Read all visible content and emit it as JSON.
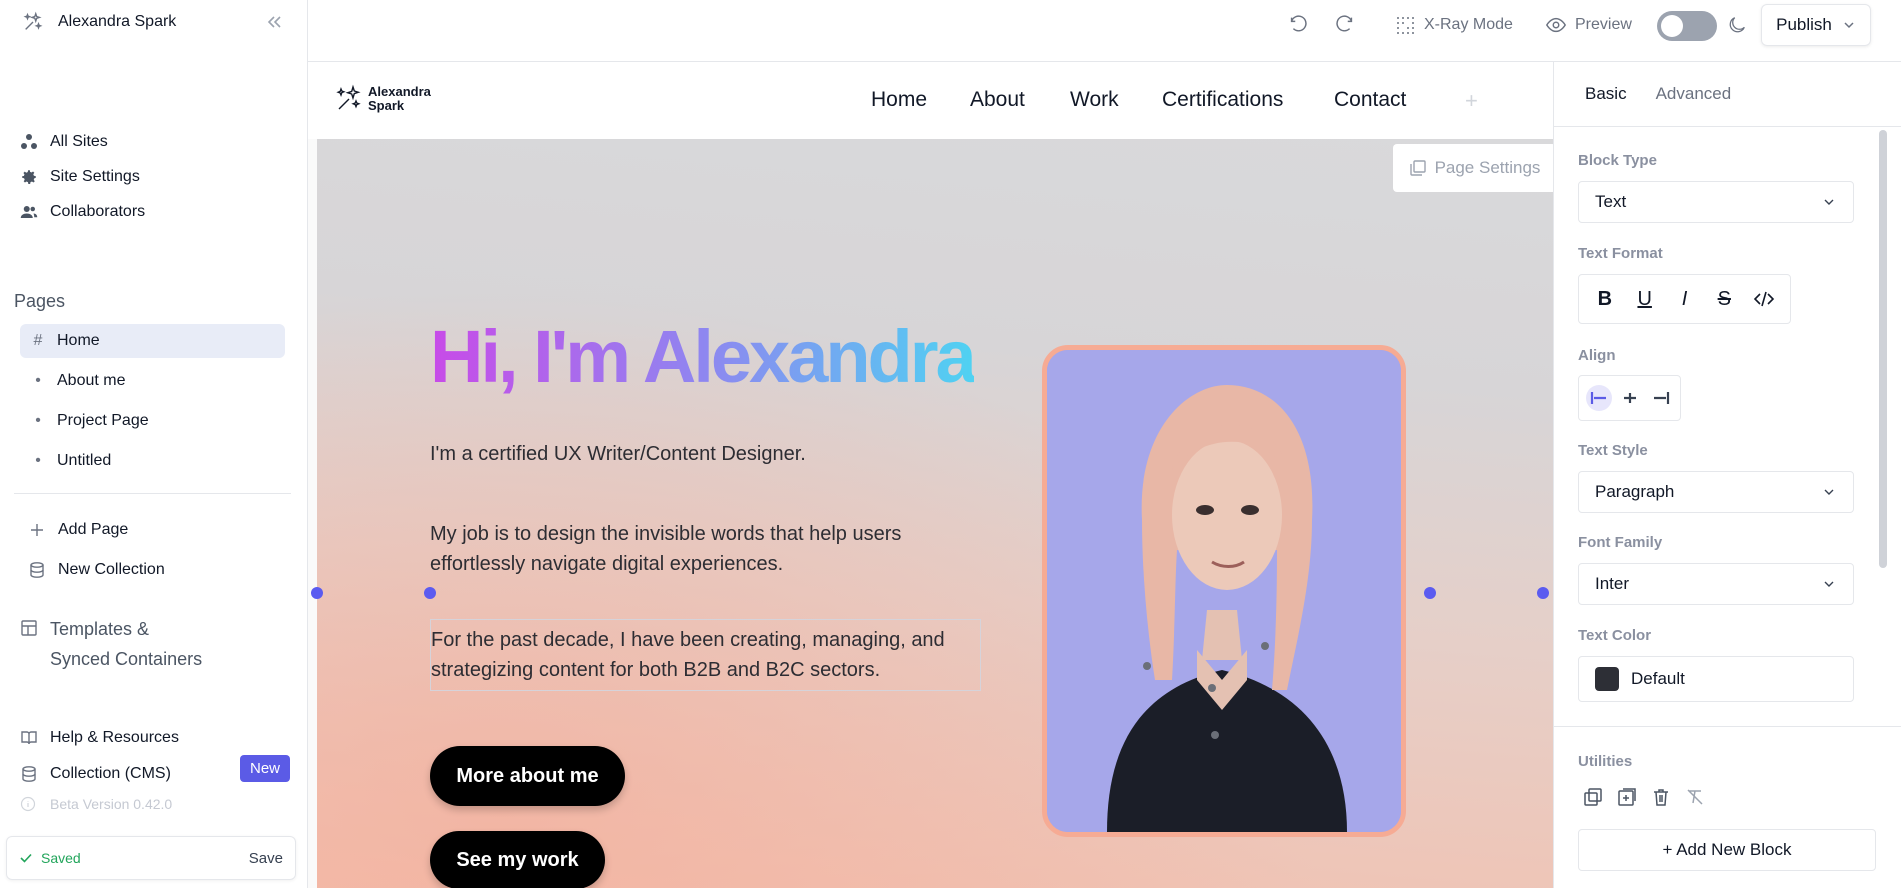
{
  "sidebar": {
    "brand_name": "Alexandra Spark",
    "nav": [
      {
        "label": "All Sites",
        "icon": "sites-icon"
      },
      {
        "label": "Site Settings",
        "icon": "gear-icon"
      },
      {
        "label": "Collaborators",
        "icon": "people-icon"
      }
    ],
    "pages_title": "Pages",
    "pages": [
      {
        "label": "Home",
        "mark": "#",
        "active": true
      },
      {
        "label": "About me",
        "mark": "•",
        "active": false
      },
      {
        "label": "Project Page",
        "mark": "•",
        "active": false
      },
      {
        "label": "Untitled",
        "mark": "•",
        "active": false
      }
    ],
    "actions": [
      {
        "label": "Add Page",
        "icon": "plus-icon"
      },
      {
        "label": "New Collection",
        "icon": "database-icon"
      }
    ],
    "templates_label": "Templates &\nSynced Containers",
    "help_label": "Help & Resources",
    "cms_label": "Collection (CMS)",
    "new_badge": "New",
    "beta_label": "Beta Version 0.42.0",
    "saved_label": "Saved",
    "save_button": "Save"
  },
  "topbar": {
    "xray_label": "X-Ray Mode",
    "preview_label": "Preview",
    "publish_label": "Publish"
  },
  "site": {
    "logo_text": "Alexandra\nSpark",
    "nav": [
      "Home",
      "About",
      "Work",
      "Certifications",
      "Contact"
    ],
    "plus": "+",
    "page_settings": "Page Settings",
    "headline": "Hi, I'm Alexandra",
    "p1": "I'm a certified UX Writer/Content Designer.",
    "p2": "My job is to design the invisible words that help users effortlessly navigate digital experiences.",
    "p3": "For the past decade, I have been creating, managing, and strategizing content for both B2B and B2C sectors.",
    "button1": "More about me",
    "button2": "See my work"
  },
  "panel": {
    "tabs": [
      "Basic",
      "Advanced"
    ],
    "block_type_label": "Block Type",
    "block_type_value": "Text",
    "text_format_label": "Text Format",
    "align_label": "Align",
    "text_style_label": "Text Style",
    "text_style_value": "Paragraph",
    "font_family_label": "Font Family",
    "font_family_value": "Inter",
    "text_color_label": "Text Color",
    "text_color_value": "Default",
    "utilities_label": "Utilities",
    "add_block": "+ Add New Block"
  },
  "colors": {
    "accent": "#5b5be6",
    "saved_green": "#22a55b",
    "photo_border": "#f6ab94"
  }
}
